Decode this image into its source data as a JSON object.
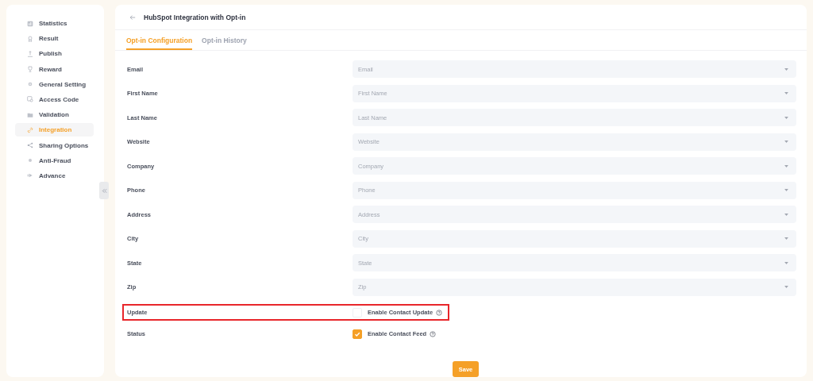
{
  "sidebar": {
    "items": [
      {
        "label": "Statistics",
        "selected": false
      },
      {
        "label": "Result",
        "selected": false
      },
      {
        "label": "Publish",
        "selected": false
      },
      {
        "label": "Reward",
        "selected": false
      },
      {
        "label": "General Setting",
        "selected": false
      },
      {
        "label": "Access Code",
        "selected": false
      },
      {
        "label": "Validation",
        "selected": false
      },
      {
        "label": "Integration",
        "selected": true
      },
      {
        "label": "Sharing Options",
        "selected": false
      },
      {
        "label": "Anti-Fraud",
        "selected": false
      },
      {
        "label": "Advance",
        "selected": false
      }
    ]
  },
  "header": {
    "title": "HubSpot Integration with Opt-in"
  },
  "tabs": [
    {
      "label": "Opt-in Configuration",
      "selected": true
    },
    {
      "label": "Opt-in History",
      "selected": false
    }
  ],
  "fields": [
    {
      "label": "Email",
      "placeholder": "Email"
    },
    {
      "label": "First Name",
      "placeholder": "First Name"
    },
    {
      "label": "Last Name",
      "placeholder": "Last Name"
    },
    {
      "label": "Website",
      "placeholder": "Website"
    },
    {
      "label": "Company",
      "placeholder": "Company"
    },
    {
      "label": "Phone",
      "placeholder": "Phone"
    },
    {
      "label": "Address",
      "placeholder": "Address"
    },
    {
      "label": "City",
      "placeholder": "City"
    },
    {
      "label": "State",
      "placeholder": "State"
    },
    {
      "label": "Zip",
      "placeholder": "Zip"
    }
  ],
  "options": [
    {
      "label": "Update",
      "option": "Enable Contact Update",
      "checked": false,
      "highlighted": true
    },
    {
      "label": "Status",
      "option": "Enable Contact Feed",
      "checked": true,
      "highlighted": false
    }
  ],
  "save_button": "Save"
}
